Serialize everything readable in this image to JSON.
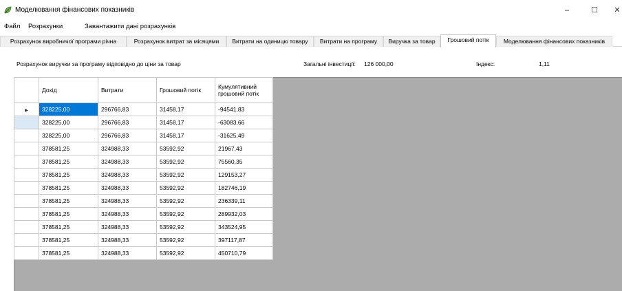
{
  "window": {
    "title": "Моделювання фінансових показників",
    "icon": "leaf-app-icon",
    "controls": {
      "minimize": "–",
      "maximize": "☐",
      "close": "✕"
    }
  },
  "menu": {
    "items": [
      "Файл",
      "Розрахунки",
      "Завантажити дані розрахунків"
    ]
  },
  "tabs": {
    "items": [
      "Розрахунок виробничої програми річна",
      "Розрахунок витрат за місяцями",
      "Витрати на одиницю товару",
      "Витрати на програму",
      "Виручка за товар",
      "Грошовий потік",
      "Моделювання фінансових показників"
    ],
    "active": "Грошовий потік"
  },
  "info": {
    "caption": "Розрахунок виручки за програму відповідно до ціни за товар",
    "investments_label": "Загальні інвестиції:",
    "investments_value": "126 000,00",
    "index_label": "Індекс:",
    "index_value": "1,11"
  },
  "grid": {
    "columns": [
      "Дохід",
      "Витрати",
      "Грошовий потік",
      "Кумулятивний грошовий потік"
    ],
    "rows": [
      [
        "328225,00",
        "296766,83",
        "31458,17",
        "-94541,83"
      ],
      [
        "328225,00",
        "296766,83",
        "31458,17",
        "-63083,66"
      ],
      [
        "328225,00",
        "296766,83",
        "31458,17",
        "-31625,49"
      ],
      [
        "378581,25",
        "324988,33",
        "53592,92",
        "21967,43"
      ],
      [
        "378581,25",
        "324988,33",
        "53592,92",
        "75560,35"
      ],
      [
        "378581,25",
        "324988,33",
        "53592,92",
        "129153,27"
      ],
      [
        "378581,25",
        "324988,33",
        "53592,92",
        "182746,19"
      ],
      [
        "378581,25",
        "324988,33",
        "53592,92",
        "236339,11"
      ],
      [
        "378581,25",
        "324988,33",
        "53592,92",
        "289932,03"
      ],
      [
        "378581,25",
        "324988,33",
        "53592,92",
        "343524,95"
      ],
      [
        "378581,25",
        "324988,33",
        "53592,92",
        "397117,87"
      ],
      [
        "378581,25",
        "324988,33",
        "53592,92",
        "450710,79"
      ]
    ],
    "current_row_marker": "▶",
    "colors": {
      "selection": "#0078d7",
      "background": "#acacac",
      "new_row": "#dbe9f6"
    }
  }
}
